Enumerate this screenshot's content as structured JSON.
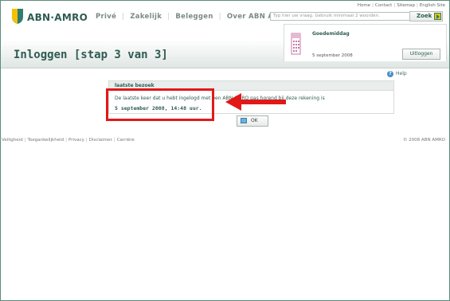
{
  "top_links": [
    "Home",
    "Contact",
    "Sitemap",
    "English Site"
  ],
  "brand": {
    "name": "ABN·AMRO",
    "accent": "#2f5b52",
    "yellow": "#f2c200"
  },
  "nav": [
    "Privé",
    "Zakelijk",
    "Beleggen",
    "Over ABN AMRO"
  ],
  "search": {
    "placeholder": "Typ hier uw vraag. Gebruik minimaal 2 woorden.",
    "button_label": "Zoek"
  },
  "welcome": {
    "greeting": "Goedemiddag",
    "date": "5 september 2008",
    "logout_label": "Uitloggen"
  },
  "page_title": "Inloggen [stap 3 van 3]",
  "help_label": "Help",
  "panel": {
    "heading": "laatste bezoek",
    "message": "De laatste keer dat u hebt ingelogd met een ABN AMRO pas horend bij deze rekening is",
    "last_visit": "5 september 2008, 14:48 uur."
  },
  "ok_label": "OK",
  "annotation_color": "#e21818",
  "footer": {
    "links": [
      "Veiligheid",
      "Toegankelijkheid",
      "Privacy",
      "Disclaimer",
      "Carrière"
    ],
    "copyright": "© 2008 ABN AMRO"
  }
}
